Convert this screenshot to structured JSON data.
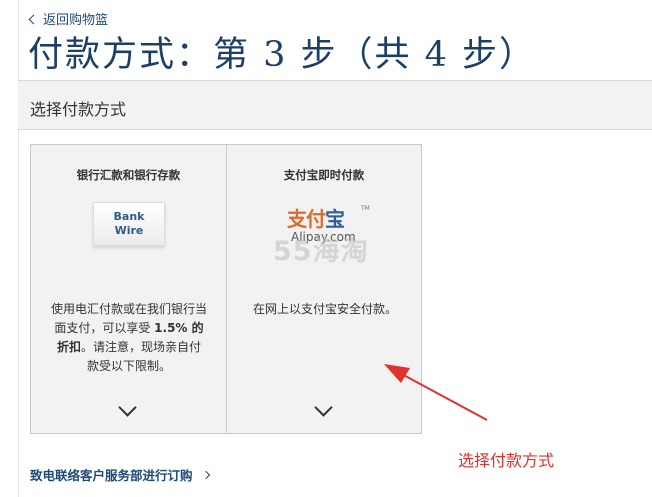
{
  "header": {
    "back_link": "返回购物篮",
    "title": "付款方式：第 3 步（共 4 步）"
  },
  "section": {
    "title": "选择付款方式"
  },
  "options": [
    {
      "title": "银行汇款和银行存款",
      "logo_line1": "Bank",
      "logo_line2": "Wire",
      "desc_part1": "使用电汇付款或在我们银行当面支付，可以享受 ",
      "desc_bold": "1.5% 的折扣",
      "desc_part2": "。请注意，现场亲自付款受以下限制。"
    },
    {
      "title": "支付宝即时付款",
      "logo_mark_1": "支付",
      "logo_mark_2": "宝",
      "logo_tm": "TM",
      "logo_text": "Alipay.com",
      "watermark": "55海淘",
      "desc": "在网上以支付宝安全付款。"
    }
  ],
  "footer": {
    "contact_link": "致电联络客户服务部进行订购"
  },
  "annotation": {
    "text": "选择付款方式",
    "color": "#e0312d"
  },
  "colors": {
    "link": "#1f4a78",
    "title": "#1c3f68",
    "panel_bg": "#f2f2f2"
  }
}
